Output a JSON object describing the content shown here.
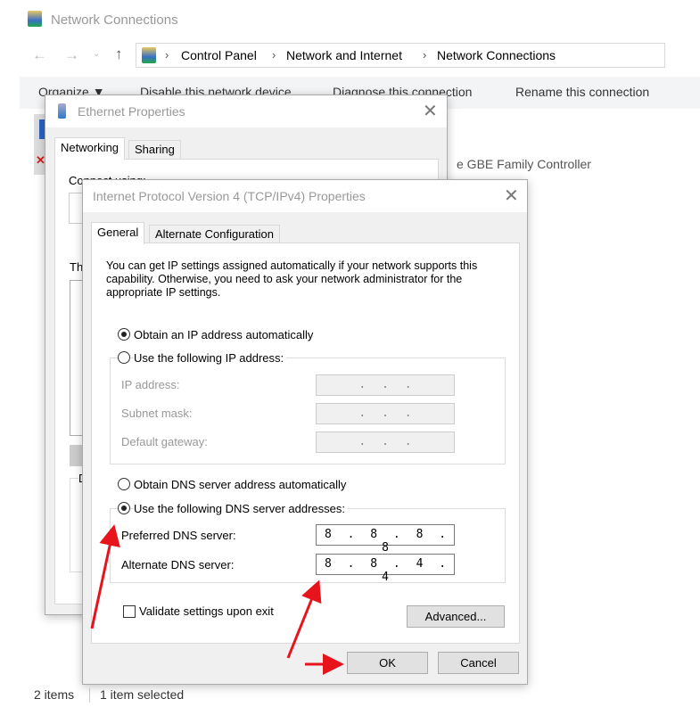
{
  "window": {
    "title": "Network Connections"
  },
  "breadcrumb": [
    "Control Panel",
    "Network and Internet",
    "Network Connections"
  ],
  "toolbar": {
    "organize": "Organize ▼",
    "disable": "Disable this network device",
    "diagnose": "Diagnose this connection",
    "rename": "Rename this connection"
  },
  "background": {
    "adapter_fragment": "e GBE Family Controller"
  },
  "status": {
    "items": "2 items",
    "selected": "1 item selected"
  },
  "ethernet_dialog": {
    "title": "Ethernet Properties",
    "tabs": [
      "Networking",
      "Sharing"
    ],
    "connect_using": "Connect using:",
    "list_fragment": "Th",
    "desc_fragment": "D"
  },
  "ipv4_dialog": {
    "title": "Internet Protocol Version 4 (TCP/IPv4) Properties",
    "tabs": [
      "General",
      "Alternate Configuration"
    ],
    "description": "You can get IP settings assigned automatically if your network supports this capability. Otherwise, you need to ask your network administrator for the appropriate IP settings.",
    "ip_auto": "Obtain an IP address automatically",
    "ip_manual": "Use the following IP address:",
    "ip_address_label": "IP address:",
    "ip_address": ".   .   .",
    "subnet_label": "Subnet mask:",
    "subnet": ".   .   .",
    "gateway_label": "Default gateway:",
    "gateway": ".   .   .",
    "dns_auto": "Obtain DNS server address automatically",
    "dns_manual": "Use the following DNS server addresses:",
    "preferred_label": "Preferred DNS server:",
    "preferred": "8 . 8 . 8 . 8",
    "alternate_label": "Alternate DNS server:",
    "alternate": "8 . 8 . 4 . 4",
    "validate": "Validate settings upon exit",
    "advanced": "Advanced...",
    "ok": "OK",
    "cancel": "Cancel",
    "ip_mode": "automatic",
    "dns_mode": "manual",
    "validate_checked": false
  },
  "colors": {
    "annotation_arrow": "#e8141b"
  }
}
